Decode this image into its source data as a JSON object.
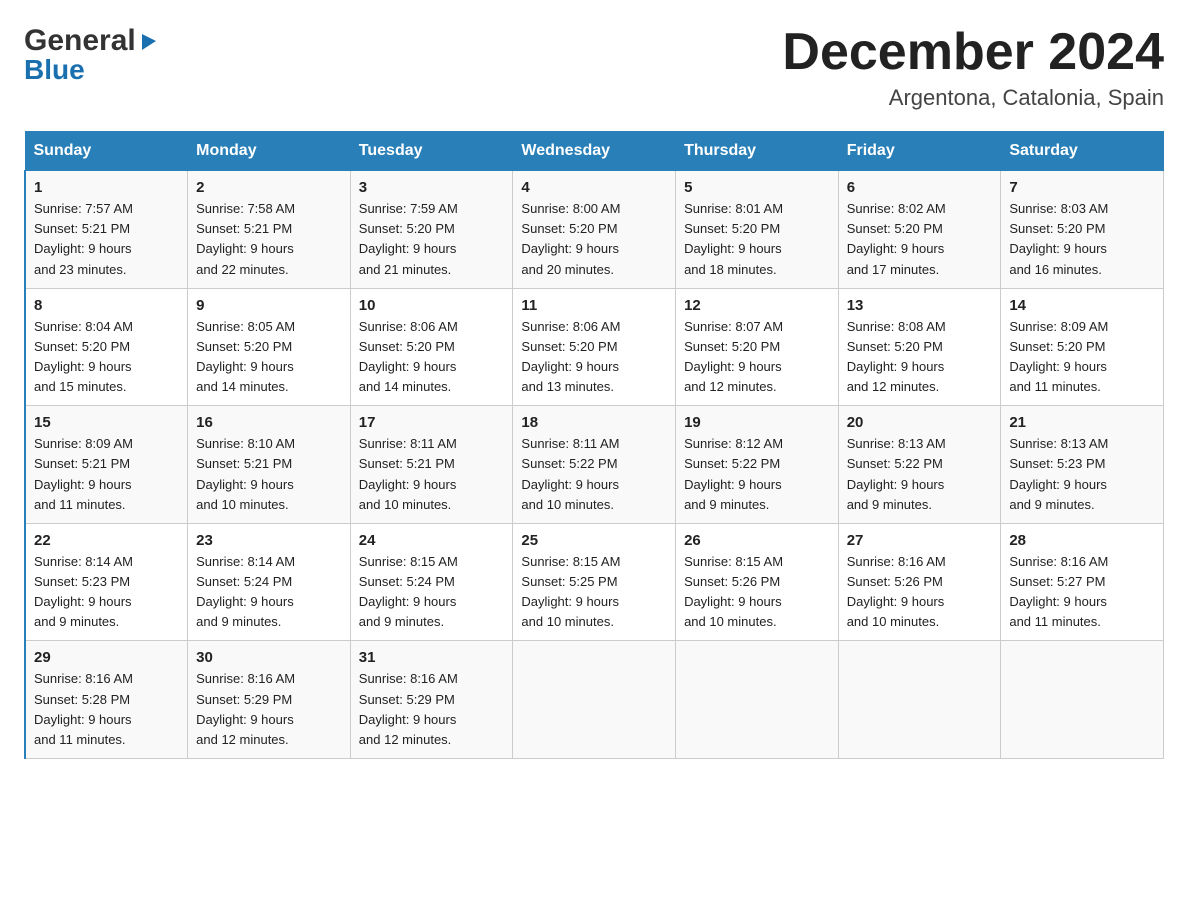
{
  "logo": {
    "general": "General",
    "blue": "Blue",
    "triangle": "▶"
  },
  "title": "December 2024",
  "location": "Argentona, Catalonia, Spain",
  "days_of_week": [
    "Sunday",
    "Monday",
    "Tuesday",
    "Wednesday",
    "Thursday",
    "Friday",
    "Saturday"
  ],
  "weeks": [
    [
      {
        "day": "1",
        "sunrise": "7:57 AM",
        "sunset": "5:21 PM",
        "daylight": "9 hours and 23 minutes."
      },
      {
        "day": "2",
        "sunrise": "7:58 AM",
        "sunset": "5:21 PM",
        "daylight": "9 hours and 22 minutes."
      },
      {
        "day": "3",
        "sunrise": "7:59 AM",
        "sunset": "5:20 PM",
        "daylight": "9 hours and 21 minutes."
      },
      {
        "day": "4",
        "sunrise": "8:00 AM",
        "sunset": "5:20 PM",
        "daylight": "9 hours and 20 minutes."
      },
      {
        "day": "5",
        "sunrise": "8:01 AM",
        "sunset": "5:20 PM",
        "daylight": "9 hours and 18 minutes."
      },
      {
        "day": "6",
        "sunrise": "8:02 AM",
        "sunset": "5:20 PM",
        "daylight": "9 hours and 17 minutes."
      },
      {
        "day": "7",
        "sunrise": "8:03 AM",
        "sunset": "5:20 PM",
        "daylight": "9 hours and 16 minutes."
      }
    ],
    [
      {
        "day": "8",
        "sunrise": "8:04 AM",
        "sunset": "5:20 PM",
        "daylight": "9 hours and 15 minutes."
      },
      {
        "day": "9",
        "sunrise": "8:05 AM",
        "sunset": "5:20 PM",
        "daylight": "9 hours and 14 minutes."
      },
      {
        "day": "10",
        "sunrise": "8:06 AM",
        "sunset": "5:20 PM",
        "daylight": "9 hours and 14 minutes."
      },
      {
        "day": "11",
        "sunrise": "8:06 AM",
        "sunset": "5:20 PM",
        "daylight": "9 hours and 13 minutes."
      },
      {
        "day": "12",
        "sunrise": "8:07 AM",
        "sunset": "5:20 PM",
        "daylight": "9 hours and 12 minutes."
      },
      {
        "day": "13",
        "sunrise": "8:08 AM",
        "sunset": "5:20 PM",
        "daylight": "9 hours and 12 minutes."
      },
      {
        "day": "14",
        "sunrise": "8:09 AM",
        "sunset": "5:20 PM",
        "daylight": "9 hours and 11 minutes."
      }
    ],
    [
      {
        "day": "15",
        "sunrise": "8:09 AM",
        "sunset": "5:21 PM",
        "daylight": "9 hours and 11 minutes."
      },
      {
        "day": "16",
        "sunrise": "8:10 AM",
        "sunset": "5:21 PM",
        "daylight": "9 hours and 10 minutes."
      },
      {
        "day": "17",
        "sunrise": "8:11 AM",
        "sunset": "5:21 PM",
        "daylight": "9 hours and 10 minutes."
      },
      {
        "day": "18",
        "sunrise": "8:11 AM",
        "sunset": "5:22 PM",
        "daylight": "9 hours and 10 minutes."
      },
      {
        "day": "19",
        "sunrise": "8:12 AM",
        "sunset": "5:22 PM",
        "daylight": "9 hours and 9 minutes."
      },
      {
        "day": "20",
        "sunrise": "8:13 AM",
        "sunset": "5:22 PM",
        "daylight": "9 hours and 9 minutes."
      },
      {
        "day": "21",
        "sunrise": "8:13 AM",
        "sunset": "5:23 PM",
        "daylight": "9 hours and 9 minutes."
      }
    ],
    [
      {
        "day": "22",
        "sunrise": "8:14 AM",
        "sunset": "5:23 PM",
        "daylight": "9 hours and 9 minutes."
      },
      {
        "day": "23",
        "sunrise": "8:14 AM",
        "sunset": "5:24 PM",
        "daylight": "9 hours and 9 minutes."
      },
      {
        "day": "24",
        "sunrise": "8:15 AM",
        "sunset": "5:24 PM",
        "daylight": "9 hours and 9 minutes."
      },
      {
        "day": "25",
        "sunrise": "8:15 AM",
        "sunset": "5:25 PM",
        "daylight": "9 hours and 10 minutes."
      },
      {
        "day": "26",
        "sunrise": "8:15 AM",
        "sunset": "5:26 PM",
        "daylight": "9 hours and 10 minutes."
      },
      {
        "day": "27",
        "sunrise": "8:16 AM",
        "sunset": "5:26 PM",
        "daylight": "9 hours and 10 minutes."
      },
      {
        "day": "28",
        "sunrise": "8:16 AM",
        "sunset": "5:27 PM",
        "daylight": "9 hours and 11 minutes."
      }
    ],
    [
      {
        "day": "29",
        "sunrise": "8:16 AM",
        "sunset": "5:28 PM",
        "daylight": "9 hours and 11 minutes."
      },
      {
        "day": "30",
        "sunrise": "8:16 AM",
        "sunset": "5:29 PM",
        "daylight": "9 hours and 12 minutes."
      },
      {
        "day": "31",
        "sunrise": "8:16 AM",
        "sunset": "5:29 PM",
        "daylight": "9 hours and 12 minutes."
      },
      null,
      null,
      null,
      null
    ]
  ]
}
